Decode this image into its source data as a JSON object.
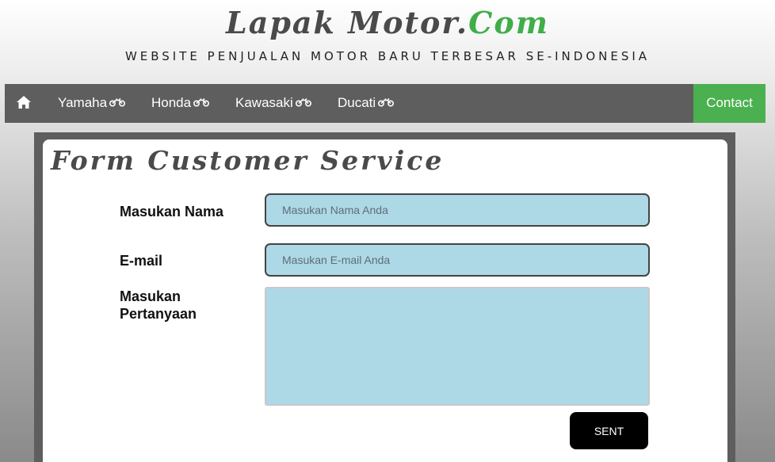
{
  "header": {
    "brand_main": "Lapak Motor.",
    "brand_accent": "Com",
    "tagline": "WEBSITE PENJUALAN MOTOR BARU TERBESAR SE-INDONESIA"
  },
  "nav": {
    "home_icon": "home-icon",
    "items": [
      {
        "label": "Yamaha",
        "icon": "motorcycle-icon"
      },
      {
        "label": "Honda",
        "icon": "motorcycle-icon"
      },
      {
        "label": "Kawasaki",
        "icon": "motorcycle-icon"
      },
      {
        "label": "Ducati",
        "icon": "motorcycle-icon"
      }
    ],
    "contact_label": "Contact"
  },
  "form": {
    "title": "Form Customer Service",
    "name_label": "Masukan Nama",
    "name_placeholder": "Masukan Nama Anda",
    "email_label": "E-mail",
    "email_placeholder": "Masukan E-mail Anda",
    "question_label": "Masukan Pertanyaan",
    "submit_label": "SENT"
  },
  "colors": {
    "nav_bg": "#5e5e5e",
    "contact_bg": "#4bb04f",
    "brand_accent": "#3fae49",
    "input_bg": "#add8e6",
    "button_bg": "#000000"
  }
}
